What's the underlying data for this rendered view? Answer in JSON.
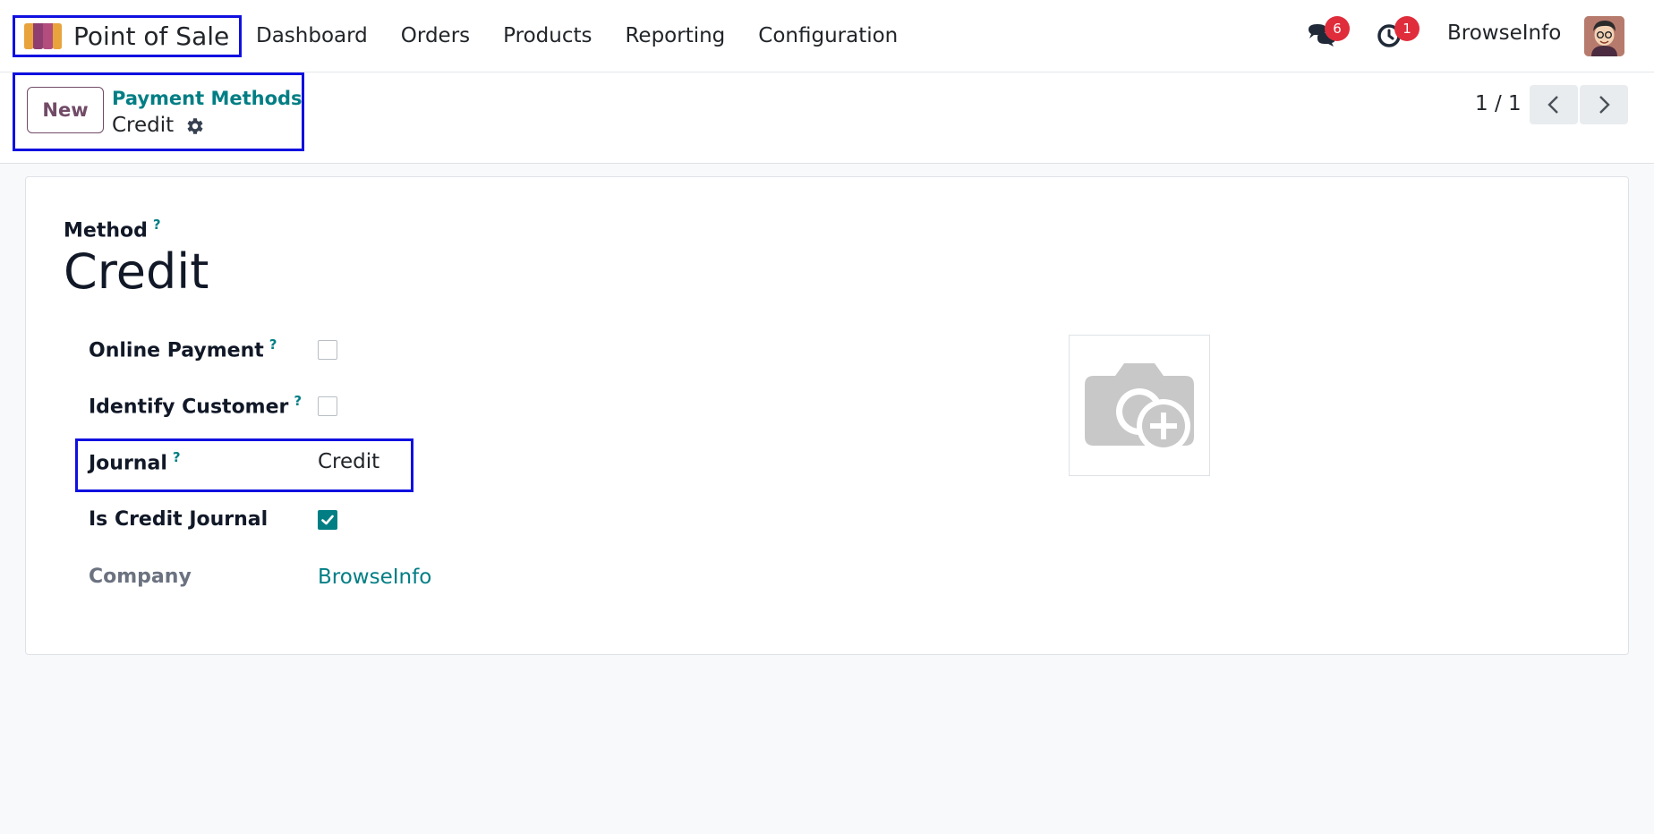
{
  "app": {
    "title": "Point of Sale",
    "logo_icon": "pos-awning-icon"
  },
  "menu": [
    "Dashboard",
    "Orders",
    "Products",
    "Reporting",
    "Configuration"
  ],
  "systray": {
    "messages_count": "6",
    "activities_count": "1",
    "user_name": "BrowseInfo",
    "messages_icon": "chat-bubbles-icon",
    "activities_icon": "clock-icon"
  },
  "control_panel": {
    "new_label": "New",
    "breadcrumb_parent": "Payment Methods",
    "breadcrumb_current": "Credit",
    "pager_text": "1 / 1"
  },
  "form": {
    "method_label": "Method",
    "help_mark": "?",
    "name": "Credit",
    "fields": {
      "online_payment": {
        "label": "Online Payment",
        "checked": false
      },
      "identify_customer": {
        "label": "Identify Customer",
        "checked": false
      },
      "journal": {
        "label": "Journal",
        "value": "Credit"
      },
      "is_credit_journal": {
        "label": "Is Credit Journal",
        "checked": true
      },
      "company": {
        "label": "Company",
        "value": "BrowseInfo"
      }
    },
    "image_placeholder_icon": "camera-add-icon"
  },
  "colors": {
    "brand_purple": "#714b67",
    "accent_teal": "#017e84",
    "badge_red": "#e02d3c",
    "highlight_blue": "#1010e0"
  }
}
